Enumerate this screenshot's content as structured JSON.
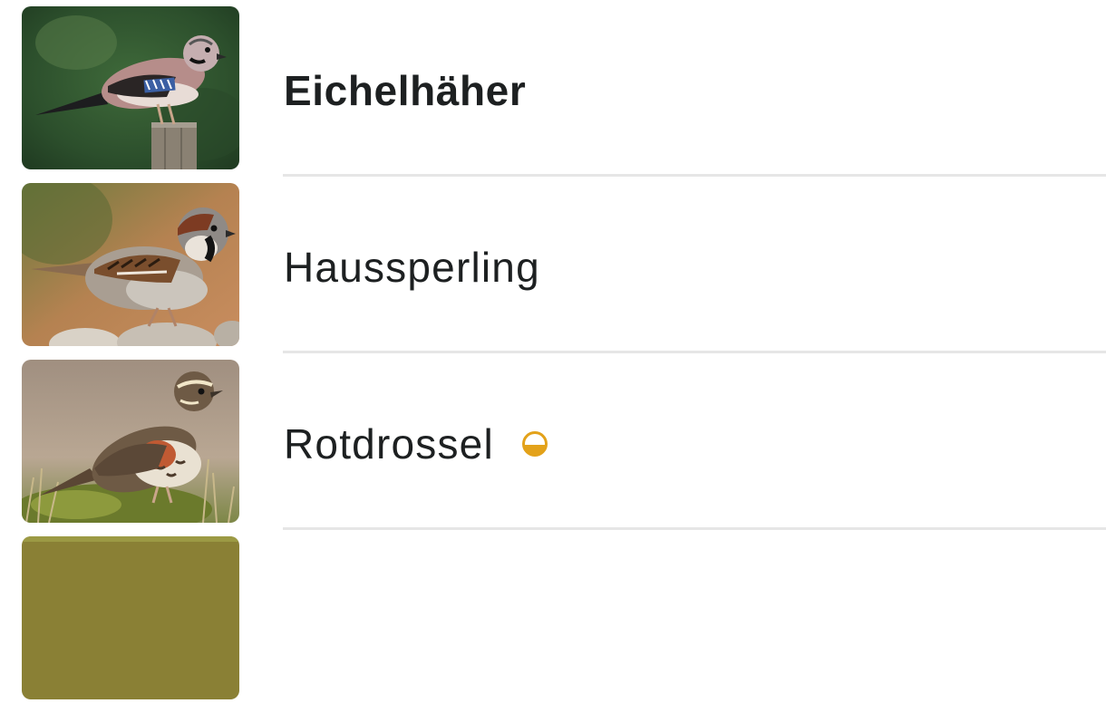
{
  "bird_list": {
    "items": [
      {
        "name": "Eichelhäher",
        "bold": true,
        "status_icon": null
      },
      {
        "name": "Haussperling",
        "bold": false,
        "status_icon": null
      },
      {
        "name": "Rotdrossel",
        "bold": false,
        "status_icon": "half-filled-circle-icon"
      },
      {
        "name": "",
        "bold": false,
        "status_icon": null
      }
    ]
  },
  "colors": {
    "text": "#1d2021",
    "divider": "#e6e6e6",
    "status_accent": "#e3a21a"
  }
}
